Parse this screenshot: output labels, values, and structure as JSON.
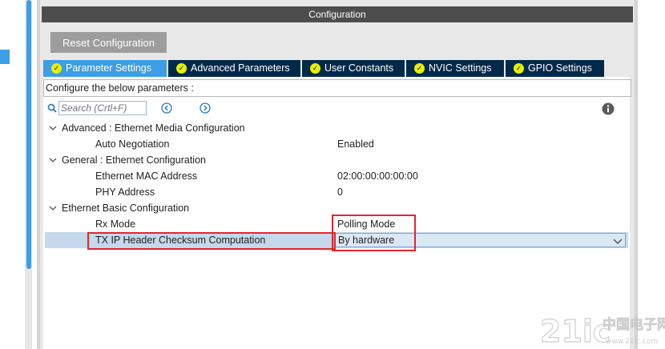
{
  "panel": {
    "title": "Configuration",
    "reset_label": "Reset Configuration"
  },
  "tabs": [
    {
      "label": "Parameter Settings",
      "active": true
    },
    {
      "label": "Advanced Parameters",
      "active": false
    },
    {
      "label": "User Constants",
      "active": false
    },
    {
      "label": "NVIC Settings",
      "active": false
    },
    {
      "label": "GPIO Settings",
      "active": false
    }
  ],
  "configure_text": "Configure the below parameters :",
  "search": {
    "placeholder": "Search (Crtl+F)"
  },
  "icons": {
    "search": "search-icon",
    "prev": "arrow-left-circle-icon",
    "next": "arrow-right-circle-icon",
    "info": "info-icon",
    "expand": "chevron-down-icon",
    "check": "check-circle-icon",
    "dropdown": "chevron-down-icon"
  },
  "categories": [
    {
      "label": "Advanced : Ethernet Media Configuration",
      "params": [
        {
          "name": "Auto Negotiation",
          "value": "Enabled"
        }
      ]
    },
    {
      "label": "General : Ethernet Configuration",
      "params": [
        {
          "name": "Ethernet MAC Address",
          "value": "02:00:00:00:00:00"
        },
        {
          "name": "PHY Address",
          "value": "0"
        }
      ]
    },
    {
      "label": "Ethernet Basic Configuration",
      "params": [
        {
          "name": "Rx Mode",
          "value": "Polling Mode"
        },
        {
          "name": "TX IP Header Checksum Computation",
          "value": "By hardware"
        }
      ]
    }
  ],
  "watermark": "21ic 中国电子网",
  "colors": {
    "accent": "#3c9ee4",
    "tab_dark": "#00294a",
    "title_bar": "#4d4d4d",
    "highlight_border": "#e0262e",
    "selected_row": "#c5d8ec"
  }
}
